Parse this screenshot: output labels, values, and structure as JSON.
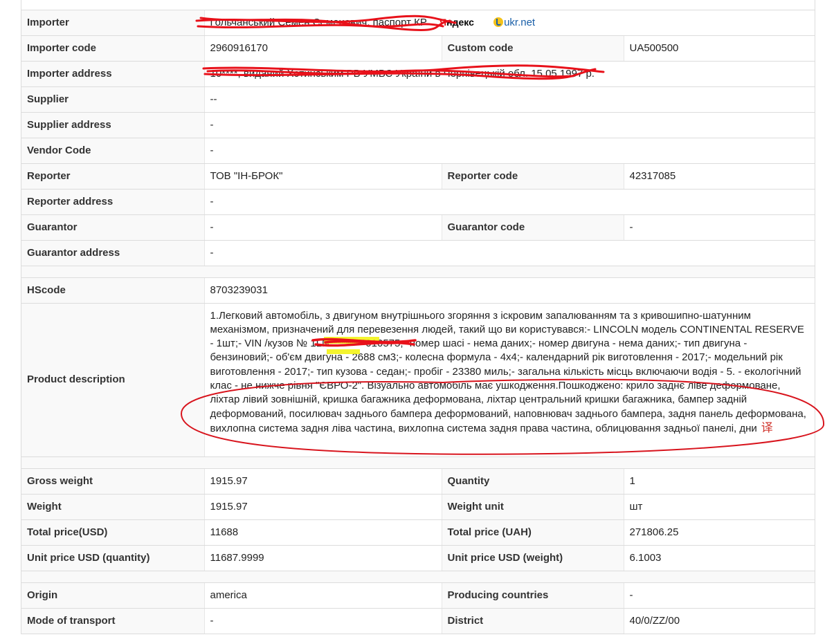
{
  "rows": {
    "importer": {
      "label": "Importer",
      "value": "Гольчанський Семен Семенович, паспорт КР",
      "logo_yandex": "Яндекс",
      "logo_ukrnet": "ukr.net"
    },
    "importer_code": {
      "label": "Importer code",
      "value": "2960916170",
      "label2": "Custom code",
      "value2": "UA500500"
    },
    "importer_address": {
      "label": "Importer address",
      "value": "10****, виданий Хотинським РВ УМВС України в Чернівецькій обл. 15.05.1997 р."
    },
    "supplier": {
      "label": "Supplier",
      "value": "--"
    },
    "supplier_address": {
      "label": "Supplier address",
      "value": "-"
    },
    "vendor_code": {
      "label": "Vendor Code",
      "value": "-"
    },
    "reporter": {
      "label": "Reporter",
      "value": "ТОВ \"ІН-БРОК\"",
      "label2": "Reporter code",
      "value2": "42317085"
    },
    "reporter_address": {
      "label": "Reporter address",
      "value": "-"
    },
    "guarantor": {
      "label": "Guarantor",
      "value": "-",
      "label2": "Guarantor code",
      "value2": "-"
    },
    "guarantor_address": {
      "label": "Guarantor address",
      "value": "-"
    },
    "hscode": {
      "label": "HScode",
      "value": "8703239031"
    },
    "product_description": {
      "label": "Product description",
      "value": "1.Легковий автомобіль, з двигуном внутрішнього згоряння з іскровим запалюванням та з кривошипно-шатунним механізмом, призначений для перевезення людей, такий що ви користувався:- LINCOLN модель CONTINENTAL RESERVE - 1шт;- VIN /кузов № 1LN*********010575;- номер шасі - нема даних;- номер двигуна - нема даних;- тип двигуна - бензиновий;- об'єм двигуна - 2688 см3;- колесна формула - 4х4;- календарний рік виготовлення - 2017;- модельний рік виготовлення - 2017;- тип кузова - седан;- пробіг - 23380 миль;- загальна кількість місць включаючи водія - 5. - екологічний клас - не нижче рівня \"ЄВРО-2\". Візуально автомобіль має ушкодження.Пошкоджено: крило заднє ліве деформоване, ліхтар лівий зовнішній, кришка багажника деформована, ліхтар центральний кришки багажника, бампер задній деформований, посилювач заднього бампера деформований, наповнювач заднього бампера, задня панель деформована, вихлопна система задня ліва частина, вихлопна система задня права частина, облицювання задньої панелі, дни",
      "translate_glyph": "译"
    },
    "gross_weight": {
      "label": "Gross weight",
      "value": "1915.97",
      "label2": "Quantity",
      "value2": "1"
    },
    "weight": {
      "label": "Weight",
      "value": "1915.97",
      "label2": "Weight unit",
      "value2": "шт"
    },
    "total_price": {
      "label": "Total price(USD)",
      "value": "11688",
      "label2": "Total price (UAH)",
      "value2": "271806.25"
    },
    "unit_price": {
      "label": "Unit price USD (quantity)",
      "value": "11687.9999",
      "label2": "Unit price USD (weight)",
      "value2": "6.1003"
    },
    "origin": {
      "label": "Origin",
      "value": "america",
      "label2": "Producing countries",
      "value2": "-"
    },
    "transport": {
      "label": "Mode of transport",
      "value": "-",
      "label2": "District",
      "value2": "40/0/ZZ/00"
    }
  },
  "colors": {
    "redaction": "#e8111a",
    "highlight": "#f2f20a",
    "annotation": "#d8141d"
  },
  "icons": {
    "translate": "translate-icon",
    "ukrnet": "ukrnet-logo-icon",
    "yandex": "yandex-logo"
  }
}
